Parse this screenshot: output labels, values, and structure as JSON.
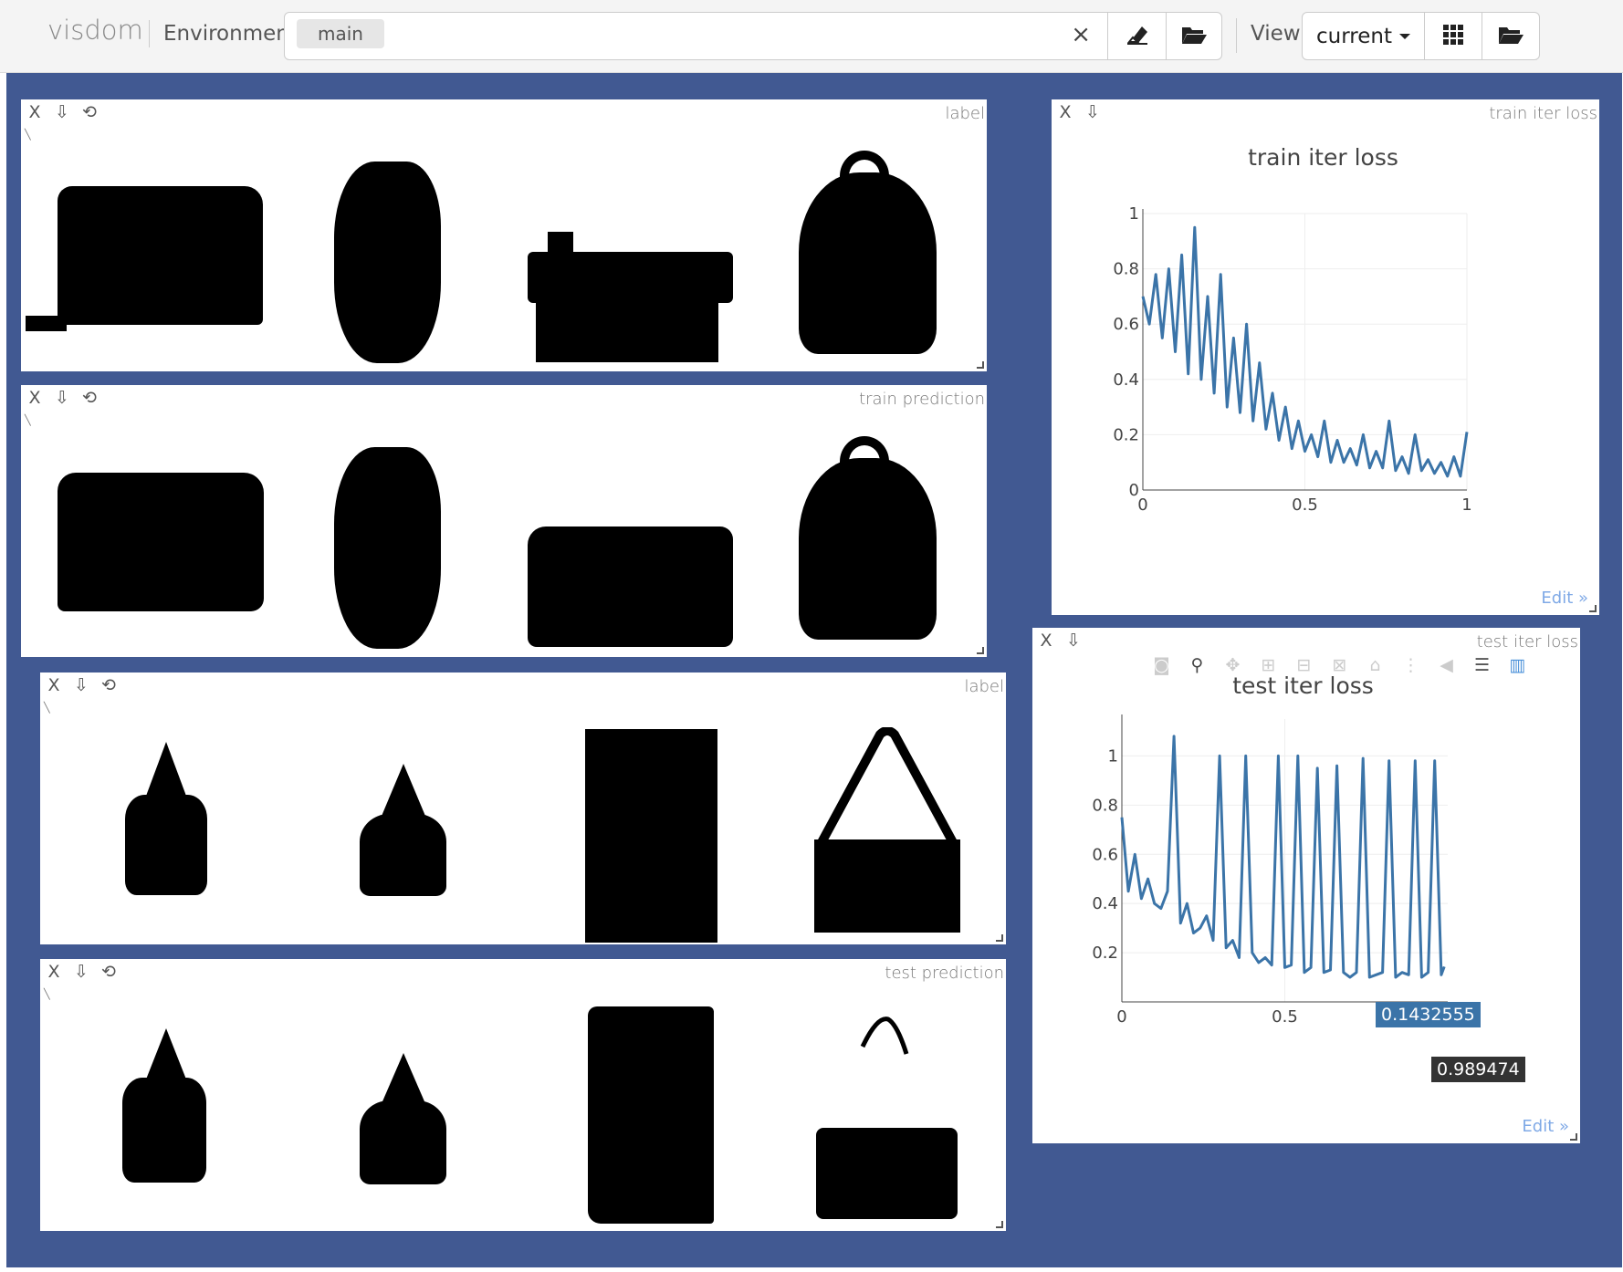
{
  "topbar": {
    "brand": "visdom",
    "environment_label": "Environment",
    "environment_tag": "main",
    "clear_symbol": "×",
    "view_label": "View",
    "view_value": "current",
    "icons": [
      "eraser-icon",
      "folder-open-icon",
      "grid-icon",
      "folder-open-icon"
    ]
  },
  "panes": {
    "label1": {
      "title": "label"
    },
    "train_pred": {
      "title": "train prediction"
    },
    "label2": {
      "title": "label"
    },
    "test_pred": {
      "title": "test prediction"
    },
    "train_loss": {
      "title": "train iter loss",
      "edit": "Edit »"
    },
    "test_loss": {
      "title": "test iter loss",
      "edit": "Edit »",
      "tooltip_y": "0.1432555",
      "tooltip_x": "0.989474"
    }
  },
  "pane_controls": {
    "close": "X",
    "download": "⇩",
    "reset": "⟲"
  },
  "colors": {
    "canvas": "#415992",
    "line": "#3b74a8",
    "tooltip_dark": "#333333",
    "edit_link": "#7fa9e6"
  },
  "chart_data": [
    {
      "type": "line",
      "title": "train iter loss",
      "xlabel": "",
      "ylabel": "",
      "xlim": [
        0,
        1
      ],
      "ylim": [
        0,
        1
      ],
      "xticks": [
        "0",
        "0.5",
        "1"
      ],
      "yticks": [
        "0",
        "0.2",
        "0.4",
        "0.6",
        "0.8",
        "1"
      ],
      "grid": true,
      "x": [
        0,
        0.02,
        0.04,
        0.06,
        0.08,
        0.1,
        0.12,
        0.14,
        0.16,
        0.18,
        0.2,
        0.22,
        0.24,
        0.26,
        0.28,
        0.3,
        0.32,
        0.34,
        0.36,
        0.38,
        0.4,
        0.42,
        0.44,
        0.46,
        0.48,
        0.5,
        0.52,
        0.54,
        0.56,
        0.58,
        0.6,
        0.62,
        0.64,
        0.66,
        0.68,
        0.7,
        0.72,
        0.74,
        0.76,
        0.78,
        0.8,
        0.82,
        0.84,
        0.86,
        0.88,
        0.9,
        0.92,
        0.94,
        0.96,
        0.98,
        1.0
      ],
      "series": [
        {
          "values": [
            0.7,
            0.6,
            0.78,
            0.55,
            0.8,
            0.5,
            0.85,
            0.42,
            0.95,
            0.4,
            0.7,
            0.35,
            0.78,
            0.3,
            0.55,
            0.28,
            0.6,
            0.25,
            0.46,
            0.22,
            0.35,
            0.18,
            0.3,
            0.15,
            0.25,
            0.14,
            0.2,
            0.12,
            0.25,
            0.1,
            0.18,
            0.1,
            0.15,
            0.09,
            0.2,
            0.08,
            0.14,
            0.08,
            0.25,
            0.07,
            0.12,
            0.06,
            0.2,
            0.07,
            0.11,
            0.06,
            0.1,
            0.05,
            0.12,
            0.05,
            0.21
          ]
        }
      ]
    },
    {
      "type": "line",
      "title": "test iter loss",
      "xlabel": "",
      "ylabel": "",
      "xlim": [
        0,
        1
      ],
      "ylim": [
        0,
        1.15
      ],
      "xticks": [
        "0",
        "0.5"
      ],
      "yticks": [
        "0.2",
        "0.4",
        "0.6",
        "0.8",
        "1"
      ],
      "grid": true,
      "x": [
        0,
        0.02,
        0.04,
        0.06,
        0.08,
        0.1,
        0.12,
        0.14,
        0.16,
        0.18,
        0.2,
        0.22,
        0.24,
        0.26,
        0.28,
        0.3,
        0.32,
        0.34,
        0.36,
        0.38,
        0.4,
        0.42,
        0.44,
        0.46,
        0.48,
        0.5,
        0.52,
        0.54,
        0.56,
        0.58,
        0.6,
        0.62,
        0.64,
        0.66,
        0.68,
        0.7,
        0.72,
        0.74,
        0.76,
        0.78,
        0.8,
        0.82,
        0.84,
        0.86,
        0.88,
        0.9,
        0.92,
        0.94,
        0.96,
        0.98,
        0.989474
      ],
      "series": [
        {
          "values": [
            0.75,
            0.45,
            0.6,
            0.42,
            0.5,
            0.4,
            0.38,
            0.45,
            1.08,
            0.32,
            0.4,
            0.28,
            0.3,
            0.35,
            0.25,
            1.0,
            0.22,
            0.25,
            0.18,
            1.0,
            0.2,
            0.16,
            0.18,
            0.15,
            1.0,
            0.14,
            0.15,
            1.0,
            0.12,
            0.14,
            0.95,
            0.12,
            0.13,
            0.96,
            0.12,
            0.1,
            0.12,
            0.99,
            0.1,
            0.11,
            0.12,
            0.98,
            0.1,
            0.12,
            0.11,
            0.98,
            0.1,
            0.12,
            0.98,
            0.11,
            0.1432555
          ]
        }
      ]
    }
  ]
}
